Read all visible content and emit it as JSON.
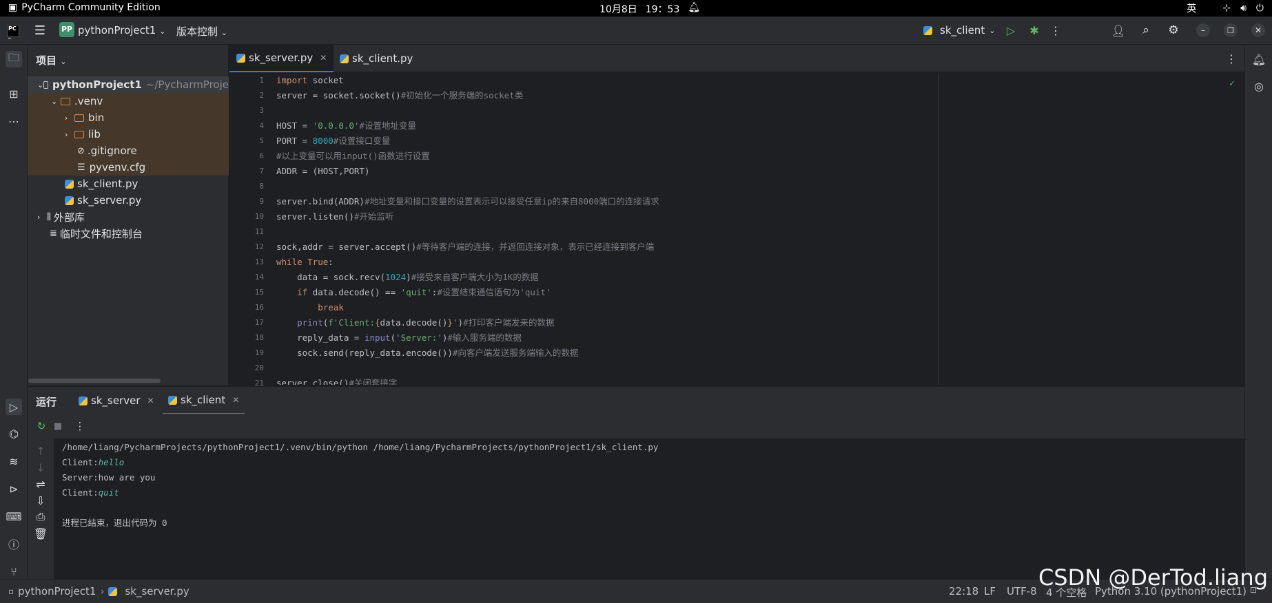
{
  "system": {
    "app_name": "PyCharm Community Edition",
    "date": "10月8日",
    "time": "19：53",
    "ime": "英"
  },
  "toolbar": {
    "project_badge": "PP",
    "project_name": "pythonProject1",
    "vcs_label": "版本控制",
    "run_config": "sk_client"
  },
  "project_panel": {
    "title": "项目",
    "items": [
      {
        "label": "pythonProject1",
        "hint": "~/PycharmProje"
      },
      {
        "label": ".venv"
      },
      {
        "label": "bin"
      },
      {
        "label": "lib"
      },
      {
        "label": ".gitignore"
      },
      {
        "label": "pyvenv.cfg"
      },
      {
        "label": "sk_client.py"
      },
      {
        "label": "sk_server.py"
      },
      {
        "label": "外部库"
      },
      {
        "label": "临时文件和控制台"
      }
    ]
  },
  "editor": {
    "tabs": [
      {
        "label": "sk_server.py",
        "active": true
      },
      {
        "label": "sk_client.py",
        "active": false
      }
    ],
    "line_numbers": [
      "1",
      "2",
      "3",
      "4",
      "5",
      "6",
      "7",
      "8",
      "9",
      "10",
      "11",
      "12",
      "13",
      "14",
      "15",
      "16",
      "17",
      "18",
      "19",
      "20",
      "21"
    ]
  },
  "run_panel": {
    "title": "运行",
    "tabs": [
      {
        "label": "sk_server"
      },
      {
        "label": "sk_client",
        "active": true
      }
    ],
    "output": {
      "cmd": "/home/liang/PycharmProjects/pythonProject1/.venv/bin/python /home/liang/PycharmProjects/pythonProject1/sk_client.py",
      "l1_prefix": "Client:",
      "l1_input": "hello",
      "l2": "Server:how are you",
      "l3_prefix": "Client:",
      "l3_input": "quit",
      "exit": "进程已结束，退出代码为 0"
    }
  },
  "status_bar": {
    "crumb_project": "pythonProject1",
    "crumb_file": "sk_server.py",
    "position": "22:18",
    "line_sep": "LF",
    "encoding": "UTF-8",
    "indent": "4 个空格",
    "interpreter": "Python 3.10 (pythonProject1)"
  },
  "watermark": "CSDN @DerTod.liang"
}
